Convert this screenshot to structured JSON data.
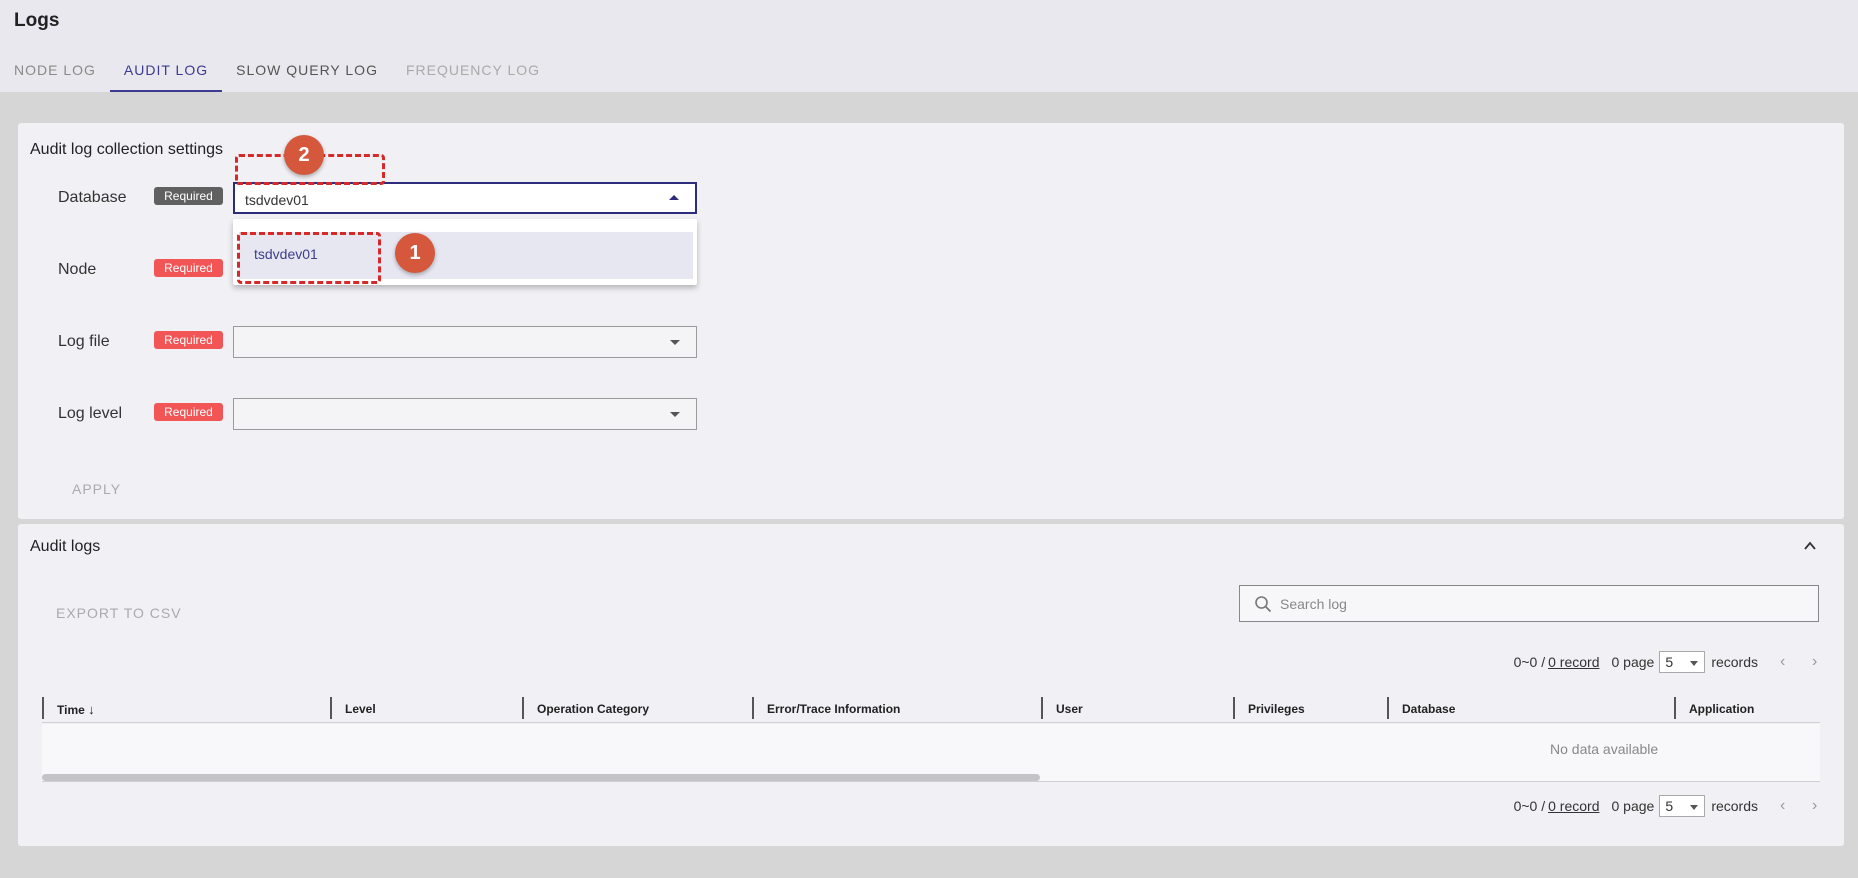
{
  "header": {
    "title": "Logs",
    "tabs": [
      {
        "label": "NODE LOG"
      },
      {
        "label": "AUDIT LOG"
      },
      {
        "label": "SLOW QUERY LOG"
      },
      {
        "label": "FREQUENCY LOG"
      }
    ]
  },
  "settings": {
    "title": "Audit log collection settings",
    "fields": [
      {
        "label": "Database",
        "badge": "Required",
        "value": "tsdvdev01"
      },
      {
        "label": "Node",
        "badge": "Required",
        "value": ""
      },
      {
        "label": "Log file",
        "badge": "Required",
        "value": ""
      },
      {
        "label": "Log level",
        "badge": "Required",
        "value": ""
      }
    ],
    "dropdown_options": [
      "tsdvdev01"
    ],
    "apply_label": "APPLY",
    "markers": [
      "1",
      "2"
    ]
  },
  "logs": {
    "title": "Audit logs",
    "export_label": "EXPORT TO CSV",
    "search_placeholder": "Search log",
    "pager": {
      "range": "0~0 /",
      "record_link": "0 record",
      "pages": "0 page",
      "page_size": "5",
      "records_label": "records",
      "prev": "‹",
      "next": "›"
    },
    "columns": [
      "Time",
      "Level",
      "Operation Category",
      "Error/Trace Information",
      "User",
      "Privileges",
      "Database",
      "Application"
    ],
    "sort_indicator": "↓",
    "empty_text": "No data available"
  }
}
